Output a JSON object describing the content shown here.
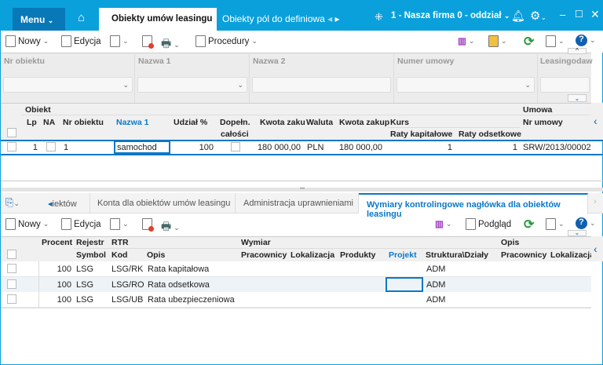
{
  "topbar": {
    "menu": "Menu",
    "tabs": [
      "Obiekty umów leasingu",
      "Obiekty pól do definiowa"
    ],
    "company": "1 - Nasza firma 0 - oddział"
  },
  "toolbar": {
    "new": "Nowy",
    "edit": "Edycja",
    "procedures": "Procedury"
  },
  "filters": {
    "labels": [
      "Nr obiektu",
      "Nazwa 1",
      "Nazwa 2",
      "Numer umowy",
      "Leasingodaw"
    ]
  },
  "grid1": {
    "group_obiekt": "Obiekt",
    "group_umowa": "Umowa",
    "group_kurs": "Kurs",
    "headers": [
      "Lp",
      "NA",
      "Nr obiektu",
      "Nazwa 1",
      "Udział %",
      "Dopełn.",
      "całości",
      "Kwota zaku",
      "Waluta",
      "Kwota zakup",
      "Raty kapitałowe",
      "Raty odsetkowe",
      "Nr umowy"
    ],
    "row": {
      "lp": "1",
      "nr": "1",
      "nazwa": "samochod",
      "udzial": "100",
      "kwota": "180 000,00",
      "waluta": "PLN",
      "kwota2": "180 000,00",
      "rk": "1",
      "ro": "1",
      "umowa": "SRW/2013/00002"
    }
  },
  "bottom_tabs": [
    "iektów",
    "Konta dla obiektów umów leasingu",
    "Administracja uprawnieniami",
    "Wymiary kontrolingowe nagłówka dla obiektów leasingu"
  ],
  "toolbar2": {
    "new": "Nowy",
    "edit": "Edycja",
    "preview": "Podgląd"
  },
  "grid2": {
    "groups": {
      "procent": "Procent",
      "rejestr": "Rejestr",
      "rtr": "RTR",
      "wymiar": "Wymiar",
      "opis": "Opis"
    },
    "headers": [
      "Symbol",
      "Kod",
      "Opis",
      "Pracownicy",
      "Lokalizacja",
      "Produkty",
      "Projekt",
      "Struktura\\Działy",
      "Pracownicy",
      "Lokalizacja"
    ],
    "rows": [
      {
        "procent": "100",
        "symbol": "LSG",
        "kod": "LSG/RK",
        "opis": "Rata kapitałowa",
        "struktura": "ADM"
      },
      {
        "procent": "100",
        "symbol": "LSG",
        "kod": "LSG/RO",
        "opis": "Rata odsetkowa",
        "struktura": "ADM"
      },
      {
        "procent": "100",
        "symbol": "LSG",
        "kod": "LSG/UB",
        "opis": "Rata ubezpieczeniowa",
        "struktura": "ADM"
      }
    ]
  },
  "colors": {
    "brand": "#0aa0dc",
    "menu": "#0878b8",
    "accent": "#0a78c8"
  }
}
